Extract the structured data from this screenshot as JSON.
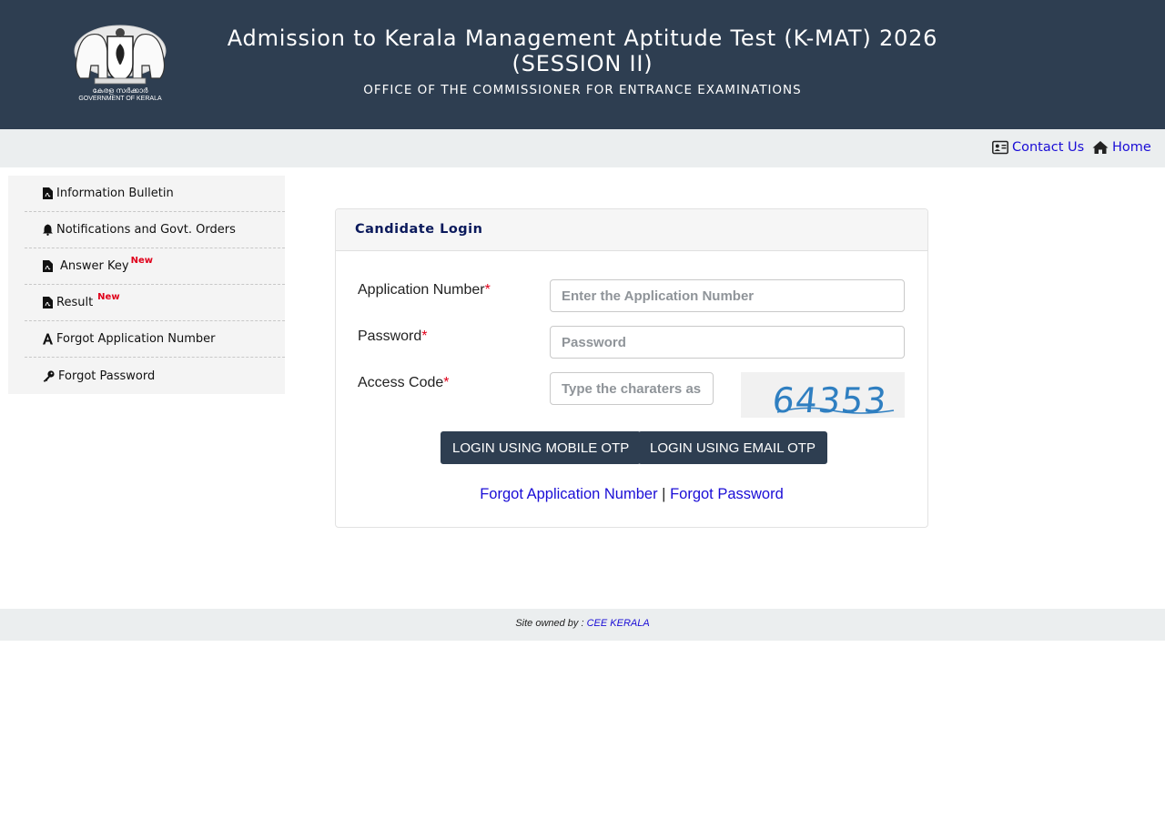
{
  "header": {
    "title": "Admission to Kerala Management Aptitude Test (K-MAT) 2026",
    "session": "(SESSION II)",
    "office": "OFFICE OF THE COMMISSIONER FOR ENTRANCE EXAMINATIONS",
    "emblem_caption_ml": "കേരള സർക്കാർ",
    "emblem_caption_en": "GOVERNMENT OF KERALA"
  },
  "topnav": {
    "contact": "Contact Us",
    "home": "Home"
  },
  "sidebar": {
    "items": [
      {
        "label": "Information Bulletin",
        "icon": "pdf-icon",
        "badge": ""
      },
      {
        "label": "Notifications and Govt. Orders",
        "icon": "bell-icon",
        "badge": ""
      },
      {
        "label": "Answer Key",
        "icon": "pdf-icon",
        "badge": "New"
      },
      {
        "label": "Result",
        "icon": "pdf-icon",
        "badge": "New"
      },
      {
        "label": "Forgot Application Number",
        "icon": "font-icon",
        "badge": ""
      },
      {
        "label": "Forgot Password",
        "icon": "key-icon",
        "badge": ""
      }
    ]
  },
  "login": {
    "title": "Candidate Login",
    "app_number_label": "Application Number",
    "app_number_placeholder": "Enter the Application Number",
    "password_label": "Password",
    "password_placeholder": "Password",
    "access_code_label": "Access Code",
    "access_code_placeholder": "Type the charaters as in image",
    "required_mark": "*",
    "captcha_text": "64353",
    "mobile_otp_button": "LOGIN USING MOBILE OTP",
    "email_otp_button": "LOGIN USING EMAIL OTP",
    "forgot_app_link": "Forgot Application Number",
    "separator": "|",
    "forgot_password_link": "Forgot Password"
  },
  "footer": {
    "owned_by": "Site owned by :",
    "owner_link": "CEE KERALA"
  },
  "colors": {
    "header_bg": "#2e3e51",
    "nav_bg": "#ebeeef",
    "link": "#1a0dd6",
    "required": "#e0001a",
    "button_bg": "#2e3e51"
  }
}
